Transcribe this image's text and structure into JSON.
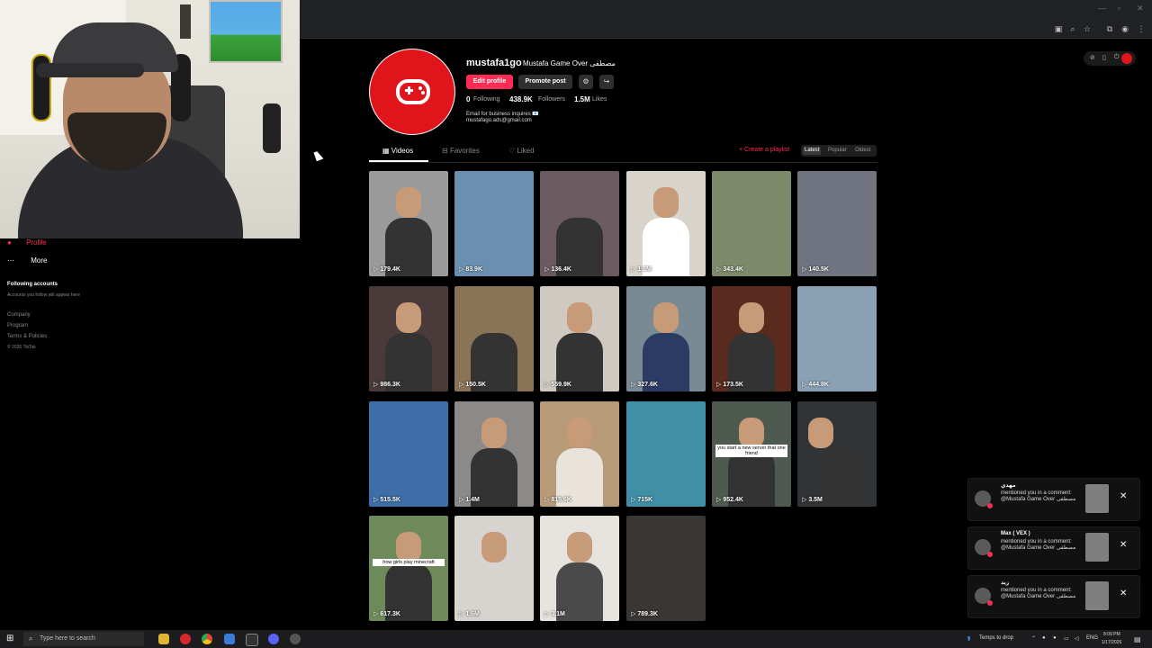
{
  "sidebar": {
    "profile_label": "Profile",
    "more_label": "More",
    "following_title": "Following accounts",
    "following_hint": "Accounts you follow will appear here",
    "links": [
      "Company",
      "Program",
      "Terms & Policies"
    ],
    "copyright": "© 2026 TikTok"
  },
  "profile": {
    "username": "mustafa1go",
    "display_name": "Mustafa Game Over مصطفى",
    "edit_label": "Edit profile",
    "promote_label": "Promote post",
    "stats": {
      "following_num": "0",
      "following_label": "Following",
      "followers_num": "438.9K",
      "followers_label": "Followers",
      "likes_num": "1.5M",
      "likes_label": "Likes"
    },
    "bio_line1": "Email for business inquires 📧",
    "bio_line2": "mustafago.ads@gmail.com"
  },
  "tabs": {
    "videos": "Videos",
    "favorites": "Favorites",
    "liked": "Liked",
    "create_playlist": "+ Create a playlist",
    "sort": [
      "Latest",
      "Popular",
      "Oldest"
    ]
  },
  "videos": [
    {
      "views": "179.4K",
      "color": "#9a9a9a"
    },
    {
      "views": "83.9K",
      "color": "#6a8fb0"
    },
    {
      "views": "136.4K",
      "color": "#6b5a60"
    },
    {
      "views": "1.3M",
      "color": "#d8d4cc"
    },
    {
      "views": "343.4K",
      "color": "#7d8a6a"
    },
    {
      "views": "140.5K",
      "color": "#6f7480"
    },
    {
      "views": "986.3K",
      "color": "#4a3a3a"
    },
    {
      "views": "150.5K",
      "color": "#8a7458"
    },
    {
      "views": "559.9K",
      "color": "#cfc9c1"
    },
    {
      "views": "327.6K",
      "color": "#7a8a94"
    },
    {
      "views": "173.5K",
      "color": "#5a2a1e"
    },
    {
      "views": "444.8K",
      "color": "#8aa0b4"
    },
    {
      "views": "515.5K",
      "color": "#3d6ea8"
    },
    {
      "views": "1.4M",
      "color": "#8c8a88"
    },
    {
      "views": "815.6K",
      "color": "#b79a78"
    },
    {
      "views": "715K",
      "color": "#3f8fa6"
    },
    {
      "views": "952.4K",
      "color": "#4e5a50"
    },
    {
      "views": "3.5M",
      "color": "#303436"
    },
    {
      "views": "617.3K",
      "color": "#6f8a5a"
    },
    {
      "views": "1.6M",
      "color": "#d7d3ce"
    },
    {
      "views": "3.1M",
      "color": "#e6e3de"
    },
    {
      "views": "789.3K",
      "color": "#3a3634"
    }
  ],
  "video_captions": {
    "v16": "you start a new server that one friend",
    "v18": "how girls play minecraft"
  },
  "notifications": [
    {
      "name": "مهدي",
      "text": "mentioned you in a comment: @Mustafa Game Over مصطفى"
    },
    {
      "name": "Max ( VEX )",
      "text": "mentioned you in a comment: @Mustafa Game Over مصطفى"
    },
    {
      "name": "زيد",
      "text": "mentioned you in a comment: @Mustafa Game Over مصطفى"
    }
  ],
  "taskbar": {
    "search_placeholder": "Type here to search",
    "weather": "Temps to drop",
    "lang": "ENG",
    "time": "8:09 PM",
    "date": "1/17/2026"
  },
  "colors": {
    "accent": "#fe2c55",
    "avatar_red": "#e0151c"
  }
}
